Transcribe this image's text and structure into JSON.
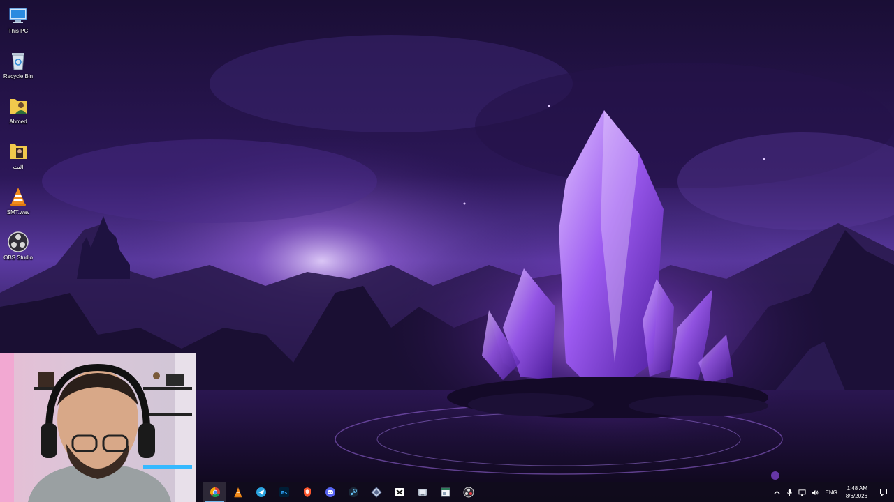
{
  "desktop": {
    "icons": [
      {
        "label": "This PC",
        "icon": "computer-icon"
      },
      {
        "label": "Recycle Bin",
        "icon": "recycle-bin-icon"
      },
      {
        "label": "Ahmed",
        "icon": "user-folder-icon"
      },
      {
        "label": "البث",
        "icon": "folder-icon"
      },
      {
        "label": "SMT.wav",
        "icon": "vlc-media-icon"
      },
      {
        "label": "OBS Studio",
        "icon": "obs-icon"
      }
    ]
  },
  "taskbar": {
    "apps": [
      {
        "name": "Google Chrome",
        "icon": "chrome-icon",
        "active": true
      },
      {
        "name": "VLC media player",
        "icon": "vlc-icon"
      },
      {
        "name": "Telegram",
        "icon": "telegram-icon"
      },
      {
        "name": "Photoshop",
        "icon": "photoshop-icon"
      },
      {
        "name": "Brave",
        "icon": "brave-icon"
      },
      {
        "name": "Discord",
        "icon": "discord-icon"
      },
      {
        "name": "Steam",
        "icon": "steam-icon"
      },
      {
        "name": "App",
        "icon": "diamond-app-icon"
      },
      {
        "name": "CapCut",
        "icon": "capcut-icon"
      },
      {
        "name": "App",
        "icon": "tablet-app-icon"
      },
      {
        "name": "App",
        "icon": "window-app-icon"
      },
      {
        "name": "OBS Studio",
        "icon": "obs-icon"
      }
    ],
    "tray": {
      "language": "ENG",
      "time": "1:48 AM",
      "date": "8/6/2026"
    }
  },
  "colors": {
    "wallpaper_dark": "#150b2c",
    "wallpaper_mid": "#4a2a86",
    "crystal": "#b06cff",
    "taskbar_bg": "#100c1c",
    "active_indicator": "#76b9ed"
  }
}
